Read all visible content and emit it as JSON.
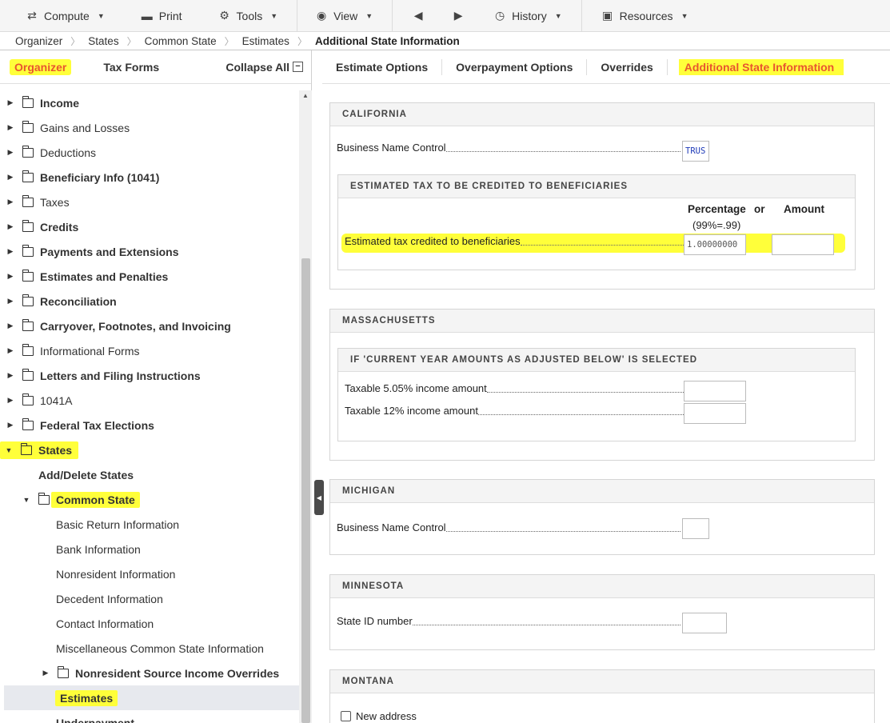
{
  "toolbar": {
    "compute": "Compute",
    "print": "Print",
    "tools": "Tools",
    "view": "View",
    "history": "History",
    "resources": "Resources"
  },
  "breadcrumb": [
    "Organizer",
    "States",
    "Common State",
    "Estimates",
    "Additional State Information"
  ],
  "left_tabs": {
    "organizer": "Organizer",
    "tax_forms": "Tax Forms",
    "collapse_all": "Collapse All"
  },
  "tree": [
    {
      "label": "Income",
      "bold": true
    },
    {
      "label": "Gains and Losses",
      "bold": false
    },
    {
      "label": "Deductions",
      "bold": false
    },
    {
      "label": "Beneficiary Info (1041)",
      "bold": true
    },
    {
      "label": "Taxes",
      "bold": false
    },
    {
      "label": "Credits",
      "bold": true
    },
    {
      "label": "Payments and Extensions",
      "bold": true
    },
    {
      "label": "Estimates and Penalties",
      "bold": true
    },
    {
      "label": "Reconciliation",
      "bold": true
    },
    {
      "label": "Carryover, Footnotes, and Invoicing",
      "bold": true
    },
    {
      "label": "Informational Forms",
      "bold": false
    },
    {
      "label": "Letters and Filing Instructions",
      "bold": true
    },
    {
      "label": "1041A",
      "bold": false
    },
    {
      "label": "Federal Tax Elections",
      "bold": true
    },
    {
      "label": "States",
      "bold": true
    },
    {
      "label": "Add/Delete States",
      "bold": true
    },
    {
      "label": "Common State",
      "bold": true
    },
    {
      "label": "Basic Return Information",
      "bold": false
    },
    {
      "label": "Bank Information",
      "bold": false
    },
    {
      "label": "Nonresident Information",
      "bold": false
    },
    {
      "label": "Decedent Information",
      "bold": false
    },
    {
      "label": "Contact Information",
      "bold": false
    },
    {
      "label": "Miscellaneous Common State Information",
      "bold": false
    },
    {
      "label": "Nonresident Source Income Overrides",
      "bold": true
    },
    {
      "label": "Estimates",
      "bold": true
    },
    {
      "label": "Underpayment",
      "bold": true
    }
  ],
  "right_tabs": [
    "Estimate Options",
    "Overpayment Options",
    "Overrides",
    "Additional State Information"
  ],
  "california": {
    "title": "CALIFORNIA",
    "business_name_control": "Business Name Control",
    "business_name_value": "TRUS",
    "sub_title": "ESTIMATED TAX TO BE CREDITED TO BENEFICIARIES",
    "col_percentage": "Percentage",
    "col_or": "or",
    "col_amount": "Amount",
    "col_note": "(99%=.99)",
    "row_label": "Estimated tax credited to beneficiaries",
    "row_percentage": "1.00000000",
    "row_amount": ""
  },
  "massachusetts": {
    "title": "MASSACHUSETTS",
    "sub_title": "IF 'CURRENT YEAR AMOUNTS AS ADJUSTED BELOW' IS SELECTED",
    "row1": "Taxable 5.05% income amount",
    "row2": "Taxable 12% income amount"
  },
  "michigan": {
    "title": "MICHIGAN",
    "business_name_control": "Business Name Control"
  },
  "minnesota": {
    "title": "MINNESOTA",
    "state_id": "State ID number"
  },
  "montana": {
    "title": "MONTANA",
    "new_address": "New address"
  }
}
